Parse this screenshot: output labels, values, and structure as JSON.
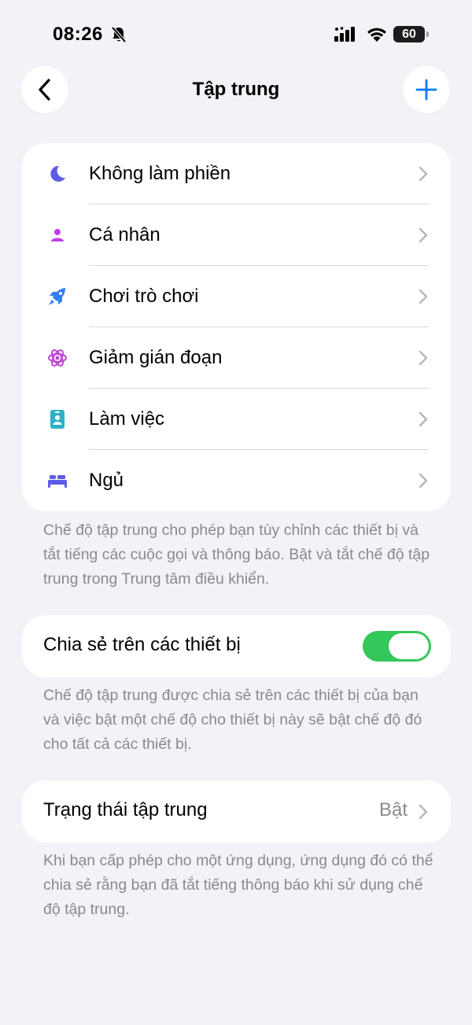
{
  "status_bar": {
    "time": "08:26",
    "battery": "60"
  },
  "nav": {
    "title": "Tập trung"
  },
  "focus_modes": [
    {
      "label": "Không làm phiền",
      "icon": "moon-icon",
      "color": "#5e5ce6"
    },
    {
      "label": "Cá nhân",
      "icon": "person-icon",
      "color": "#bf3fe8"
    },
    {
      "label": "Chơi trò chơi",
      "icon": "rocket-icon",
      "color": "#2f7cf6"
    },
    {
      "label": "Giảm gián đoạn",
      "icon": "atom-icon",
      "color": "#c242d8"
    },
    {
      "label": "Làm việc",
      "icon": "id-badge-icon",
      "color": "#30b0c7"
    },
    {
      "label": "Ngủ",
      "icon": "bed-icon",
      "color": "#5e5ce6"
    }
  ],
  "focus_note": "Chế độ tập trung cho phép bạn tùy chỉnh các thiết bị và tắt tiếng các cuộc gọi và thông báo. Bật và tắt chế độ tập trung trong Trung tâm điều khiển.",
  "share": {
    "label": "Chia sẻ trên các thiết bị",
    "enabled": true,
    "toggle_color": "#34c759",
    "note": "Chế độ tập trung được chia sẻ trên các thiết bị của bạn và việc bật một chế độ cho thiết bị này sẽ bật chế độ đó cho tất cả các thiết bị."
  },
  "focus_status": {
    "label": "Trạng thái tập trung",
    "value": "Bật",
    "note": "Khi bạn cấp phép cho một ứng dụng, ứng dụng đó có thể chia sẻ rằng bạn đã tắt tiếng thông báo khi sử dụng chế độ tập trung."
  },
  "accent_color": "#007aff"
}
